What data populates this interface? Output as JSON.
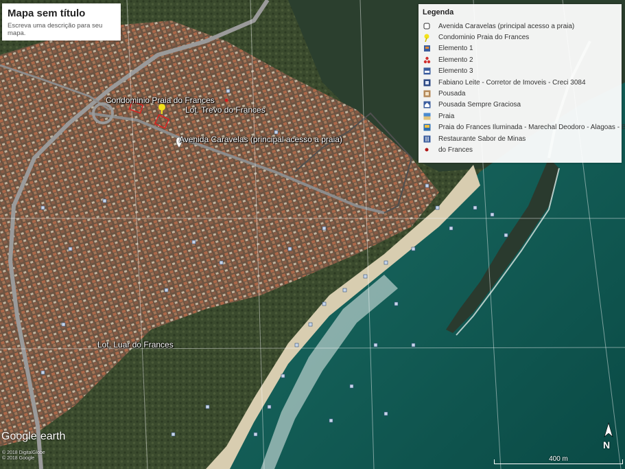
{
  "title": "Mapa sem título",
  "description": "Escreva uma descrição para seu mapa.",
  "legend": {
    "title": "Legenda",
    "items": [
      {
        "label": "Avenida Caravelas (principal acesso a praia)",
        "icon": "white-square-icon"
      },
      {
        "label": "Condominio Praia do Frances",
        "icon": "yellow-pin-icon"
      },
      {
        "label": "Elemento 1",
        "icon": "building-icon"
      },
      {
        "label": "Elemento 2",
        "icon": "red-dots-icon"
      },
      {
        "label": "Elemento 3",
        "icon": "bed-icon"
      },
      {
        "label": "Fabiano Leite - Corretor de Imoveis - Creci 3084",
        "icon": "office-icon"
      },
      {
        "label": "Pousada",
        "icon": "house-icon"
      },
      {
        "label": "Pousada Sempre Graciosa",
        "icon": "lodge-icon"
      },
      {
        "label": "Praia",
        "icon": "beach-icon"
      },
      {
        "label": "Praia do Frances Iluminada - Marechal Deodoro - Alagoas - Brasil",
        "icon": "photo-icon"
      },
      {
        "label": "Restaurante Sabor de Minas",
        "icon": "restaurant-icon"
      },
      {
        "label": "do Frances",
        "icon": "red-dot-icon"
      }
    ]
  },
  "map_labels": {
    "condominio": "Condominio Praia do Frances",
    "trevo": "Lot. Trevo do Frances",
    "avenida": "Avenida Caravelas (principal acesso a praia)",
    "luar": "Lot. Luar do Frances"
  },
  "branding": {
    "google": "Google",
    "earth": "earth",
    "copyright_1": "© 2018 DigitalGlobe",
    "copyright_2": "© 2018 Google"
  },
  "north_label": "N",
  "scale_label": "400 m",
  "colors": {
    "sea": "#0f5650",
    "land": "#3d4a2f",
    "urban": "#7a5a45",
    "sand": "#d8cdb0",
    "road": "#8c8c8c",
    "boundary": "#e02020",
    "pin": "#f3e21a"
  }
}
